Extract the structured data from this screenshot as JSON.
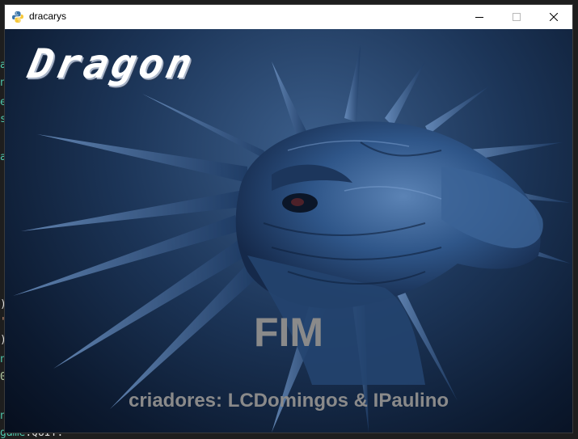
{
  "window": {
    "title": "dracarys",
    "icon": "python-icon"
  },
  "game": {
    "logo": "Dragon",
    "end_text": "FIM",
    "credits": "criadores: LCDomingos & IPaulino"
  },
  "background_editor": {
    "bottom_fragment_prefix": "game",
    "bottom_fragment_suffix": ".QUIT:",
    "left_fragments": [
      "a",
      "n",
      "e",
      "s",
      "a",
      ")",
      "'",
      ")",
      "n",
      "0",
      "n"
    ]
  },
  "colors": {
    "sky_dark": "#0c1a30",
    "sky_light": "#3c5f8c",
    "text_grey": "#8a8a8a"
  }
}
